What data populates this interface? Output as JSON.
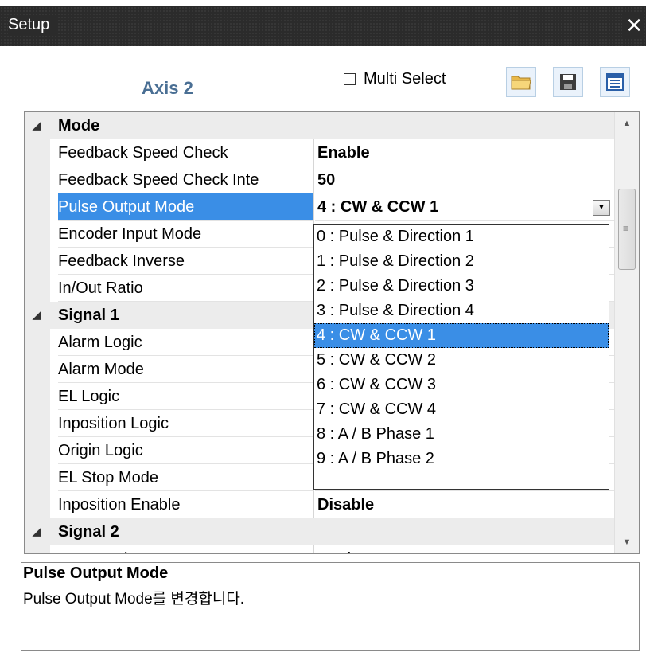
{
  "window": {
    "title": "Setup",
    "close_glyph": "✕"
  },
  "toolbar": {
    "axis_label": "Axis  2",
    "multi_select_label": "Multi Select",
    "multi_select_checked": false,
    "buttons": [
      {
        "icon": "folder-open-icon"
      },
      {
        "icon": "save-icon"
      },
      {
        "icon": "list-view-icon"
      }
    ]
  },
  "grid": {
    "categories": [
      {
        "name": "Mode",
        "properties": [
          {
            "name": "Feedback Speed Check",
            "value": "Enable"
          },
          {
            "name": "Feedback Speed Check Inte",
            "value": "50"
          },
          {
            "name": "Pulse Output Mode",
            "value": "4 : CW & CCW 1",
            "selected": true
          },
          {
            "name": "Encoder Input Mode",
            "value": ""
          },
          {
            "name": "Feedback Inverse",
            "value": ""
          },
          {
            "name": "In/Out Ratio",
            "value": ""
          }
        ]
      },
      {
        "name": "Signal 1",
        "properties": [
          {
            "name": "Alarm Logic",
            "value": ""
          },
          {
            "name": "Alarm Mode",
            "value": ""
          },
          {
            "name": "EL Logic",
            "value": ""
          },
          {
            "name": "Inposition Logic",
            "value": ""
          },
          {
            "name": "Origin Logic",
            "value": ""
          },
          {
            "name": "EL Stop Mode",
            "value": ""
          },
          {
            "name": "Inposition Enable",
            "value": "Disable"
          }
        ]
      },
      {
        "name": "Signal 2",
        "properties": [
          {
            "name": "CMP Logic",
            "value": "Logic A"
          }
        ]
      }
    ]
  },
  "dropdown": {
    "options": [
      "0 : Pulse & Direction 1",
      "1 : Pulse & Direction 2",
      "2 : Pulse & Direction 3",
      "3 : Pulse & Direction 4",
      "4 : CW & CCW 1",
      "5 : CW & CCW 2",
      "6 : CW & CCW 3",
      "7 : CW & CCW 4",
      "8 : A / B Phase 1",
      "9 : A / B Phase 2"
    ],
    "highlighted_index": 4
  },
  "description": {
    "title": "Pulse Output Mode",
    "text": "Pulse Output Mode를 변경합니다."
  },
  "colors": {
    "selection": "#3a8ee6",
    "axis_label": "#4a6f94",
    "titlebar": "#2b2b2b"
  }
}
